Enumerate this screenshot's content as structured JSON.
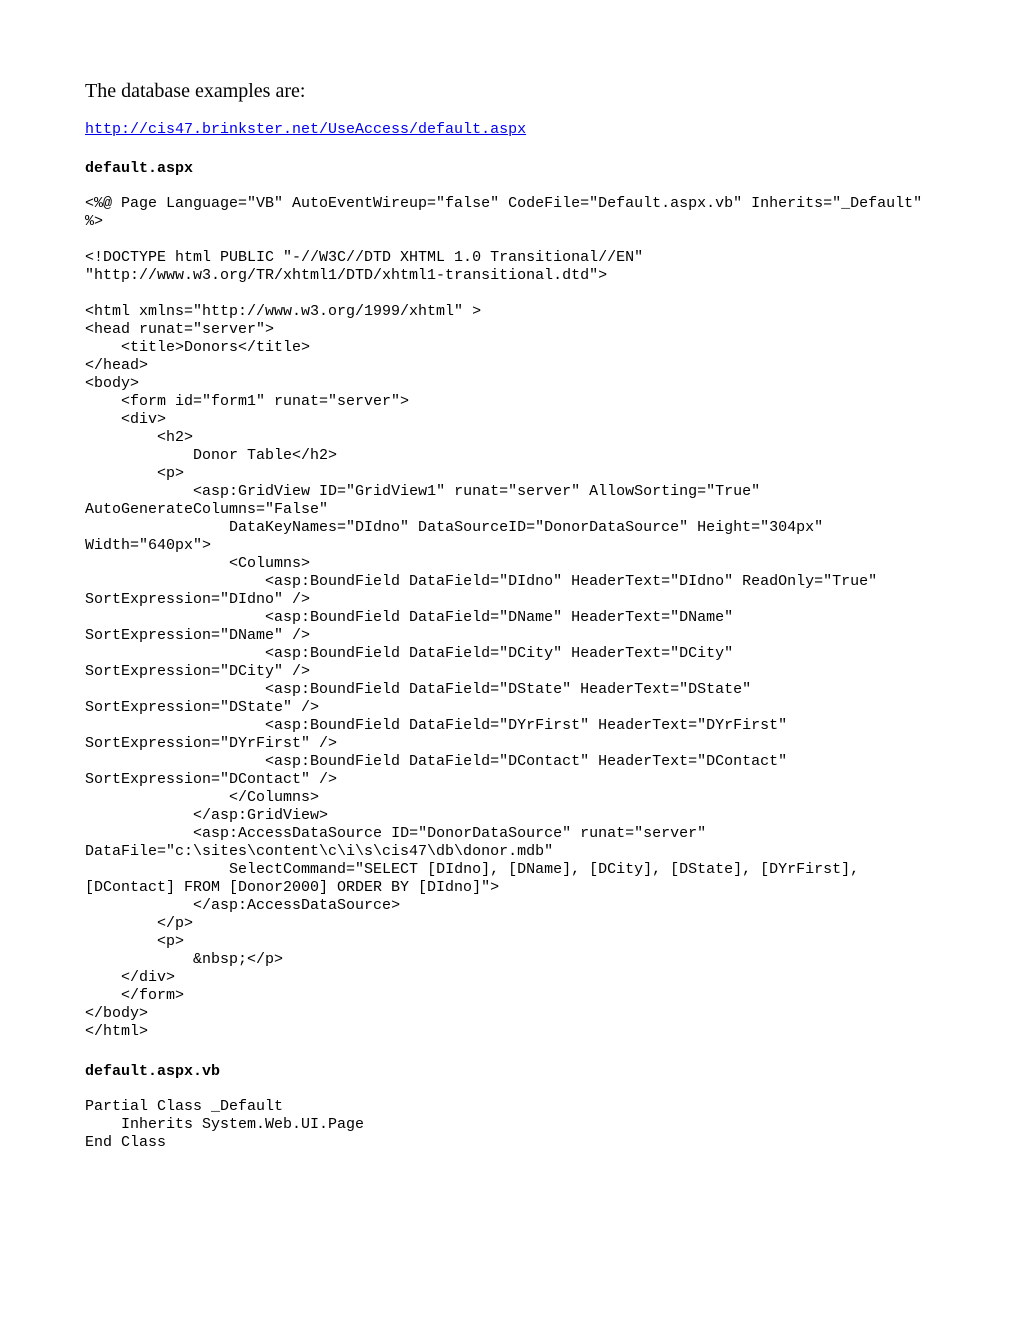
{
  "intro": "The database examples are:",
  "link": "http://cis47.brinkster.net/UseAccess/default.aspx",
  "file1_name": "default.aspx",
  "file1_code": "<%@ Page Language=\"VB\" AutoEventWireup=\"false\" CodeFile=\"Default.aspx.vb\" Inherits=\"_Default\" %>\n\n<!DOCTYPE html PUBLIC \"-//W3C//DTD XHTML 1.0 Transitional//EN\" \"http://www.w3.org/TR/xhtml1/DTD/xhtml1-transitional.dtd\">\n\n<html xmlns=\"http://www.w3.org/1999/xhtml\" >\n<head runat=\"server\">\n    <title>Donors</title>\n</head>\n<body>\n    <form id=\"form1\" runat=\"server\">\n    <div>\n        <h2>\n            Donor Table</h2>\n        <p>\n            <asp:GridView ID=\"GridView1\" runat=\"server\" AllowSorting=\"True\" AutoGenerateColumns=\"False\"\n                DataKeyNames=\"DIdno\" DataSourceID=\"DonorDataSource\" Height=\"304px\" Width=\"640px\">\n                <Columns>\n                    <asp:BoundField DataField=\"DIdno\" HeaderText=\"DIdno\" ReadOnly=\"True\" SortExpression=\"DIdno\" />\n                    <asp:BoundField DataField=\"DName\" HeaderText=\"DName\" SortExpression=\"DName\" />\n                    <asp:BoundField DataField=\"DCity\" HeaderText=\"DCity\" SortExpression=\"DCity\" />\n                    <asp:BoundField DataField=\"DState\" HeaderText=\"DState\" SortExpression=\"DState\" />\n                    <asp:BoundField DataField=\"DYrFirst\" HeaderText=\"DYrFirst\" SortExpression=\"DYrFirst\" />\n                    <asp:BoundField DataField=\"DContact\" HeaderText=\"DContact\" SortExpression=\"DContact\" />\n                </Columns>\n            </asp:GridView>\n            <asp:AccessDataSource ID=\"DonorDataSource\" runat=\"server\" DataFile=\"c:\\sites\\content\\c\\i\\s\\cis47\\db\\donor.mdb\"\n                SelectCommand=\"SELECT [DIdno], [DName], [DCity], [DState], [DYrFirst], [DContact] FROM [Donor2000] ORDER BY [DIdno]\">\n            </asp:AccessDataSource>\n        </p>\n        <p>\n            &nbsp;</p>\n    </div>\n    </form>\n</body>\n</html>",
  "file2_name": "default.aspx.vb",
  "file2_code": "Partial Class _Default\n    Inherits System.Web.UI.Page\nEnd Class"
}
